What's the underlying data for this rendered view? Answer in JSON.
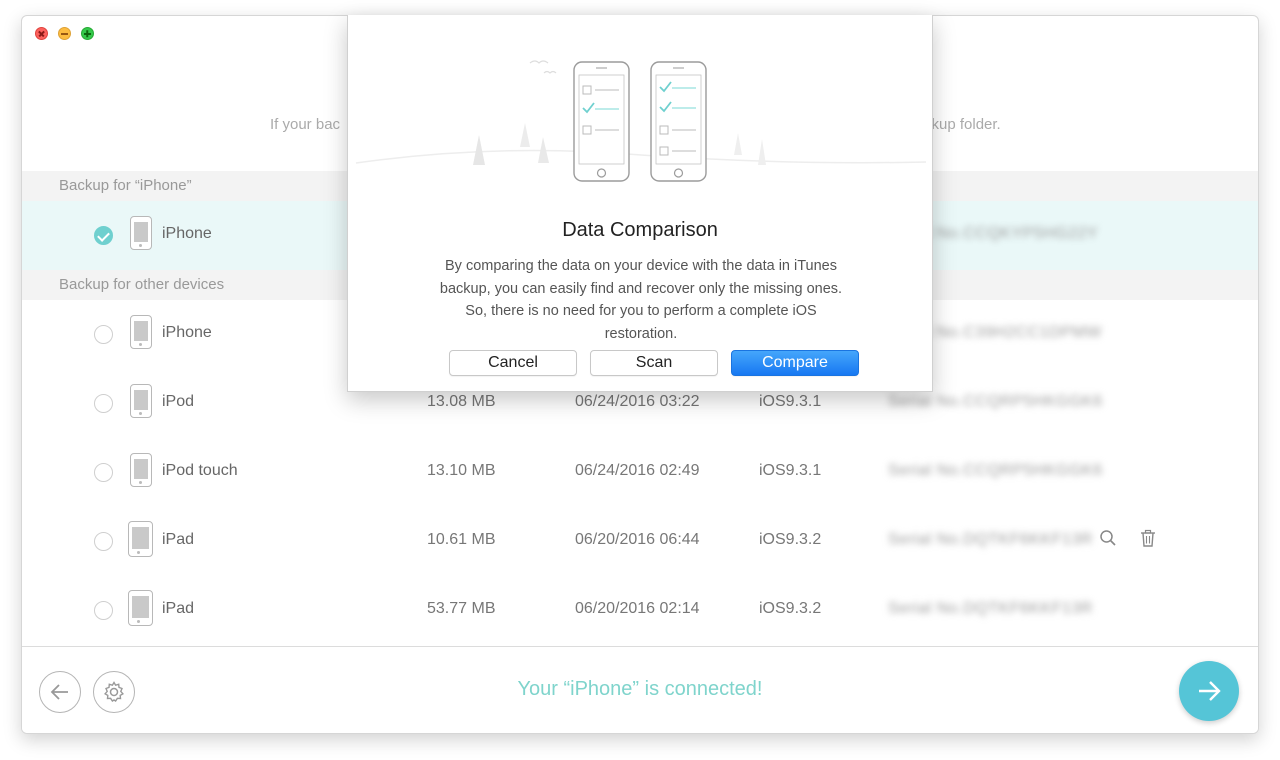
{
  "window": {
    "subtitle_left": "If your bac",
    "subtitle_right": "ckup folder."
  },
  "groups": {
    "current": "Backup for “iPhone”",
    "other": "Backup for other devices"
  },
  "rows": [
    {
      "name": "iPhone",
      "size": "",
      "date": "",
      "ios": "",
      "serial": "Serial No.CCQKYP5HG22Y",
      "checked": true,
      "device": "iphone"
    },
    {
      "name": "iPhone",
      "size": "",
      "date": "",
      "ios": "",
      "serial": "Serial No.C39H2CC1DPMW",
      "checked": false,
      "device": "iphone"
    },
    {
      "name": "iPod",
      "size": "13.08 MB",
      "date": "06/24/2016 03:22",
      "ios": "iOS9.3.1",
      "serial": "Serial No.CCQRP5HKGGK6",
      "checked": false,
      "device": "ipod"
    },
    {
      "name": "iPod touch",
      "size": "13.10 MB",
      "date": "06/24/2016 02:49",
      "ios": "iOS9.3.1",
      "serial": "Serial No.CCQRP5HKGGK6",
      "checked": false,
      "device": "ipod"
    },
    {
      "name": "iPad",
      "size": "10.61 MB",
      "date": "06/20/2016 06:44",
      "ios": "iOS9.3.2",
      "serial": "Serial No.DQTKF6KKF13R",
      "checked": false,
      "device": "ipad"
    },
    {
      "name": "iPad",
      "size": "53.77 MB",
      "date": "06/20/2016 02:14",
      "ios": "iOS9.3.2",
      "serial": "Serial No.DQTKF6KKF13R",
      "checked": false,
      "device": "ipad"
    }
  ],
  "footer": {
    "status": "Your “iPhone” is connected!",
    "back_icon": "arrow-left-icon",
    "settings_icon": "gear-icon",
    "next_icon": "arrow-right-icon"
  },
  "dialog": {
    "title": "Data Comparison",
    "description": "By comparing the data on your device with the data in iTunes backup, you can easily find and recover only the missing ones. So, there is no need for you to perform a complete iOS restoration.",
    "cancel_label": "Cancel",
    "scan_label": "Scan",
    "compare_label": "Compare"
  },
  "colors": {
    "accent": "#55c5d7",
    "status": "#7fd4cc",
    "primary_button": "#1778f2",
    "selected_row": "#eaf8f8"
  }
}
